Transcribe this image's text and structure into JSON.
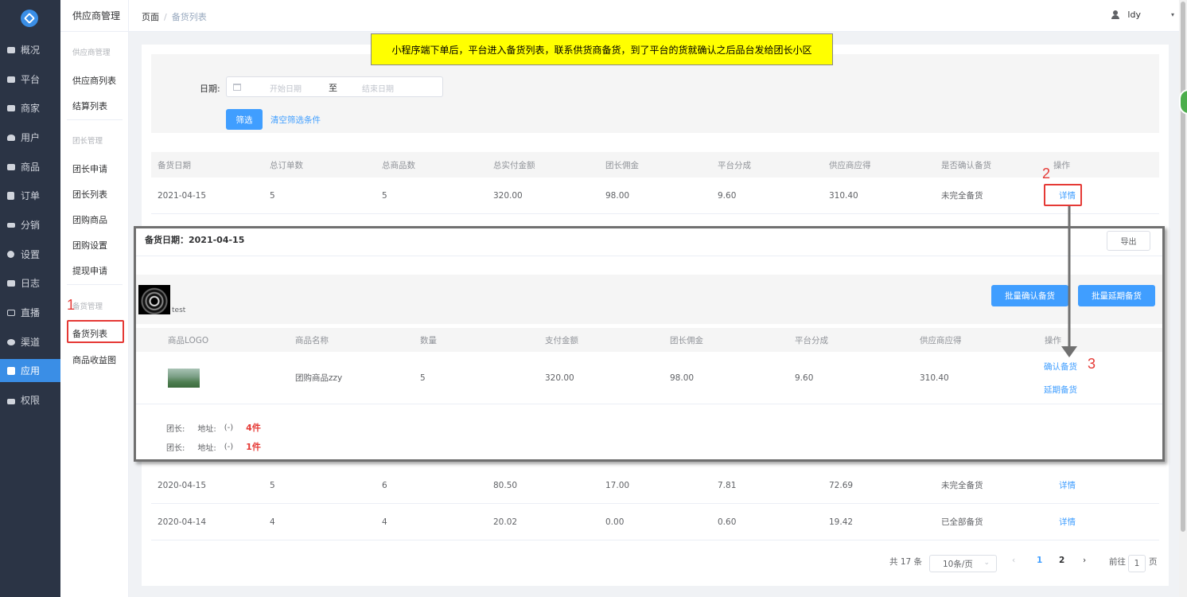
{
  "sidebar": {
    "items": [
      {
        "label": "概况",
        "icon": "message-icon"
      },
      {
        "label": "平台",
        "icon": "monitor-icon"
      },
      {
        "label": "商家",
        "icon": "store-icon"
      },
      {
        "label": "用户",
        "icon": "user-icon"
      },
      {
        "label": "商品",
        "icon": "tag-icon"
      },
      {
        "label": "订单",
        "icon": "order-icon"
      },
      {
        "label": "分销",
        "icon": "hierarchy-icon"
      },
      {
        "label": "设置",
        "icon": "gear-icon"
      },
      {
        "label": "日志",
        "icon": "book-icon"
      },
      {
        "label": "直播",
        "icon": "live-icon"
      },
      {
        "label": "渠道",
        "icon": "channel-icon"
      },
      {
        "label": "应用",
        "icon": "grid-icon",
        "active": true
      },
      {
        "label": "权限",
        "icon": "lock-icon"
      }
    ]
  },
  "subbar": {
    "title": "供应商管理",
    "group1": "供应商管理",
    "item_supplier_list": "供应商列表",
    "item_settlement_list": "结算列表",
    "group2": "团长管理",
    "item_leader_apply": "团长申请",
    "item_leader_list": "团长列表",
    "item_group_goods": "团购商品",
    "item_group_settings": "团购设置",
    "item_withdraw": "提现申请",
    "group3": "备货管理",
    "item_stock_list": "备货列表",
    "item_goods_income": "商品收益图"
  },
  "header": {
    "breadcrumb_root": "页面",
    "breadcrumb_sep": "/",
    "breadcrumb_current": "备货列表",
    "user_name": "ldy",
    "caret": "▾"
  },
  "note": "小程序端下单后，平台进入备货列表，联系供货商备货，到了平台的货就确认之后品台发给团长小区",
  "filter": {
    "date_label": "日期:",
    "start_placeholder": "开始日期",
    "to_label": "至",
    "end_placeholder": "结束日期",
    "filter_button": "筛选",
    "clear_link": "清空筛选条件"
  },
  "table": {
    "headers": [
      "备货日期",
      "总订单数",
      "总商品数",
      "总实付金额",
      "团长佣金",
      "平台分成",
      "供应商应得",
      "是否确认备货",
      "操作"
    ],
    "rows": [
      {
        "date": "2021-04-15",
        "orders": "5",
        "goods": "5",
        "paid": "320.00",
        "commission": "98.00",
        "platform": "9.60",
        "supplier": "310.40",
        "status": "未完全备货",
        "action": "详情"
      },
      {
        "date": "2020-04-15",
        "orders": "5",
        "goods": "6",
        "paid": "80.50",
        "commission": "17.00",
        "platform": "7.81",
        "supplier": "72.69",
        "status": "未完全备货",
        "action": "详情"
      },
      {
        "date": "2020-04-14",
        "orders": "4",
        "goods": "4",
        "paid": "20.02",
        "commission": "0.00",
        "platform": "0.60",
        "supplier": "19.42",
        "status": "已全部备货",
        "action": "详情"
      }
    ]
  },
  "detail": {
    "title": "备货日期：2021-04-15",
    "export_button": "导出",
    "shop_name": "test",
    "batch_confirm": "批量确认备货",
    "batch_delay": "批量延期备货",
    "headers": [
      "商品LOGO",
      "商品名称",
      "数量",
      "支付金额",
      "团长佣金",
      "平台分成",
      "供应商应得",
      "操作"
    ],
    "row": {
      "name": "团购商品zzy",
      "qty": "5",
      "paid": "320.00",
      "commission": "98.00",
      "platform": "9.60",
      "supplier": "310.40",
      "confirm": "确认备货",
      "delay": "延期备货"
    },
    "leaders": [
      {
        "leader": "团长:",
        "address": "地址:",
        "value": "(-)",
        "count": "4件"
      },
      {
        "leader": "团长:",
        "address": "地址:",
        "value": "(-)",
        "count": "1件"
      }
    ]
  },
  "annotations": {
    "n1": "1",
    "n2": "2",
    "n3": "3"
  },
  "pagination": {
    "total": "共 17 条",
    "page_size": "10条/页",
    "prev": "‹",
    "pages": [
      "1",
      "2"
    ],
    "next": "›",
    "goto": "前往",
    "goto_value": "1",
    "page_unit": "页"
  },
  "colors": {
    "primary": "#409eff",
    "sidebar": "#2b3445",
    "annotation": "#e53935",
    "note_bg": "#ffff00"
  }
}
